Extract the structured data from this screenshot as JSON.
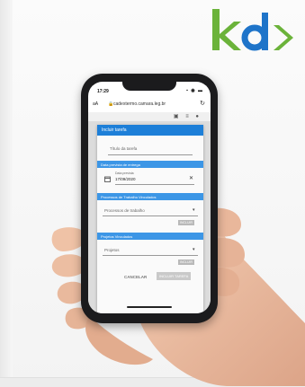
{
  "logo": {
    "text": "kd>",
    "color_k": "#6bb33a",
    "color_d": "#1e74c9",
    "color_arrow": "#6bb33a"
  },
  "status_bar": {
    "time": "17:29",
    "indicators": "▪ ◉ ▬"
  },
  "browser": {
    "text_size_label": "aA",
    "url": "cadextermo.camara.leg.br",
    "reload_icon": "reload-icon"
  },
  "modal": {
    "title": "Incluir tarefa",
    "task_title_placeholder": "Título da tarefa",
    "deadline_section": "Data prevista de entrega",
    "deadline_label": "Data prevista",
    "deadline_value": "17/09/2020",
    "process_section": "Processos de Trabalho Vinculados",
    "process_select": "Processos de trabalho",
    "process_add": "INCLUIR",
    "project_section": "Projetos Vinculados",
    "project_select": "Projetos",
    "project_add": "INCLUIR",
    "cancel_label": "CANCELAR",
    "submit_label": "INCLUIR TAREFA"
  },
  "colors": {
    "header_blue": "#1d7fd8",
    "section_blue": "#3c96e6"
  }
}
